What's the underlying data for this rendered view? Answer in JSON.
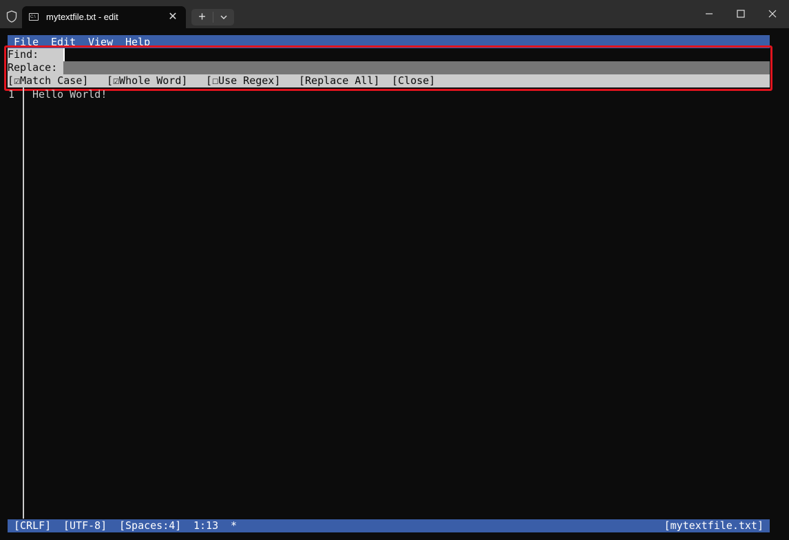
{
  "window": {
    "tab_title": "mytextfile.txt - edit",
    "tab_icon_text": "C:\\",
    "tab_close_glyph": "✕",
    "new_tab_glyph": "+"
  },
  "menu": {
    "items": [
      "File",
      "Edit",
      "View",
      "Help"
    ]
  },
  "find_panel": {
    "find_label": "Find:",
    "find_value": "",
    "replace_label": "Replace:",
    "replace_value": "",
    "match_case": "[☑Match Case]",
    "whole_word": "[☑Whole Word]",
    "use_regex": "[☐Use Regex]",
    "replace_all": "[Replace All]",
    "close": "[Close]",
    "options_state": {
      "match_case_checked": true,
      "whole_word_checked": true,
      "use_regex_checked": false
    },
    "highlight_color": "#e0141e"
  },
  "editor": {
    "lines": [
      {
        "number": "1",
        "text": "Hello World!"
      }
    ]
  },
  "status": {
    "line_ending": "[CRLF]",
    "encoding": "[UTF-8]",
    "indent": "[Spaces:4]",
    "position": "1:13",
    "modified": "*",
    "filename": "[mytextfile.txt]"
  },
  "colors": {
    "accent_bar": "#3a5ea8",
    "background": "#0c0c0c",
    "panel_gray": "#cccccc",
    "input_gray": "#767676"
  }
}
